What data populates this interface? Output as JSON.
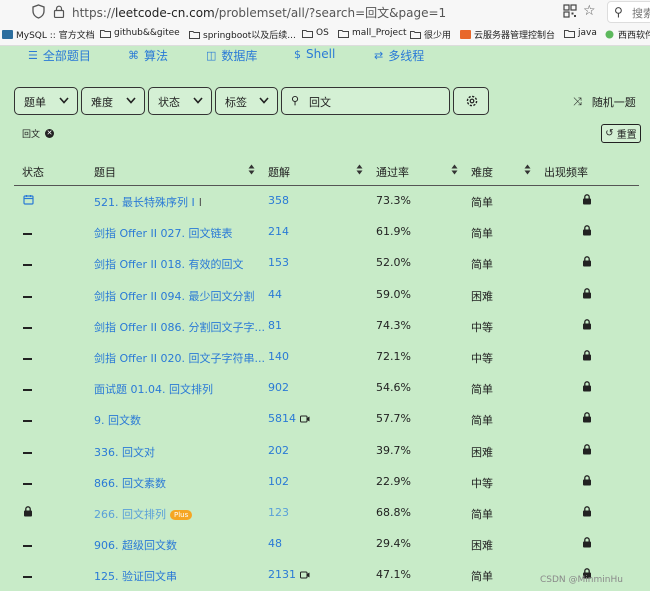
{
  "browser": {
    "url_host": "leetcode-cn.com",
    "url_prefix": "https://",
    "url_path": "/problemset/all/?search=回文&page=1",
    "search_placeholder": "搜索"
  },
  "bookmarks": [
    {
      "label": "MySQL :: 官方文档",
      "icon": "mysql-icon"
    },
    {
      "label": "github&&gitee",
      "icon": "folder-icon"
    },
    {
      "label": "springboot以及后续...",
      "icon": "folder-icon"
    },
    {
      "label": "OS",
      "icon": "folder-icon"
    },
    {
      "label": "mall_Project",
      "icon": "folder-icon"
    },
    {
      "label": "很少用",
      "icon": "folder-icon"
    },
    {
      "label": "云服务器管理控制台",
      "icon": "cloud-icon"
    },
    {
      "label": "java",
      "icon": "folder-icon"
    },
    {
      "label": "西西软件",
      "icon": "site-icon"
    }
  ],
  "nav": {
    "all_problems": "全部题目",
    "algorithms": "算法",
    "database": "数据库",
    "shell": "Shell",
    "concurrency": "多线程"
  },
  "filters": {
    "list": "题单",
    "difficulty": "难度",
    "status": "状态",
    "tags": "标签",
    "search_value": "回文",
    "random": "随机一题",
    "active_tag": "回文",
    "reset": "重置"
  },
  "table": {
    "headers": {
      "status": "状态",
      "title": "题目",
      "solutions": "题解",
      "acceptance": "通过率",
      "difficulty": "难度",
      "frequency": "出现频率"
    },
    "rows": [
      {
        "status": "calendar",
        "title": "521. 最长特殊序列 Ⅰ",
        "solutions": "358",
        "acceptance": "73.3%",
        "difficulty": "简单",
        "video": false,
        "plus": false
      },
      {
        "status": "dash",
        "title": "剑指 Offer II 027. 回文链表",
        "solutions": "214",
        "acceptance": "61.9%",
        "difficulty": "简单",
        "video": false,
        "plus": false
      },
      {
        "status": "dash",
        "title": "剑指 Offer II 018. 有效的回文",
        "solutions": "153",
        "acceptance": "52.0%",
        "difficulty": "简单",
        "video": false,
        "plus": false
      },
      {
        "status": "dash",
        "title": "剑指 Offer II 094. 最少回文分割",
        "solutions": "44",
        "acceptance": "59.0%",
        "difficulty": "困难",
        "video": false,
        "plus": false
      },
      {
        "status": "dash",
        "title": "剑指 Offer II 086. 分割回文子字...",
        "solutions": "81",
        "acceptance": "74.3%",
        "difficulty": "中等",
        "video": false,
        "plus": false
      },
      {
        "status": "dash",
        "title": "剑指 Offer II 020. 回文子字符串...",
        "solutions": "140",
        "acceptance": "72.1%",
        "difficulty": "中等",
        "video": false,
        "plus": false
      },
      {
        "status": "dash",
        "title": "面试题 01.04. 回文排列",
        "solutions": "902",
        "acceptance": "54.6%",
        "difficulty": "简单",
        "video": false,
        "plus": false
      },
      {
        "status": "dash",
        "title": "9. 回文数",
        "solutions": "5814",
        "acceptance": "57.7%",
        "difficulty": "简单",
        "video": true,
        "plus": false
      },
      {
        "status": "dash",
        "title": "336. 回文对",
        "solutions": "202",
        "acceptance": "39.7%",
        "difficulty": "困难",
        "video": false,
        "plus": false
      },
      {
        "status": "dash",
        "title": "866. 回文素数",
        "solutions": "102",
        "acceptance": "22.9%",
        "difficulty": "中等",
        "video": false,
        "plus": false
      },
      {
        "status": "lock",
        "title": "266. 回文排列",
        "solutions": "123",
        "acceptance": "68.8%",
        "difficulty": "简单",
        "video": false,
        "plus": true
      },
      {
        "status": "dash",
        "title": "906. 超级回文数",
        "solutions": "48",
        "acceptance": "29.4%",
        "difficulty": "困难",
        "video": false,
        "plus": false
      },
      {
        "status": "dash",
        "title": "125. 验证回文串",
        "solutions": "2131",
        "acceptance": "47.1%",
        "difficulty": "简单",
        "video": true,
        "plus": false
      }
    ],
    "plus_label": "Plus"
  },
  "watermark": "CSDN @MinminHu",
  "colors": {
    "accent": "#2a7ad6",
    "background": "#c8ebc8",
    "plus": "#f5a623"
  }
}
